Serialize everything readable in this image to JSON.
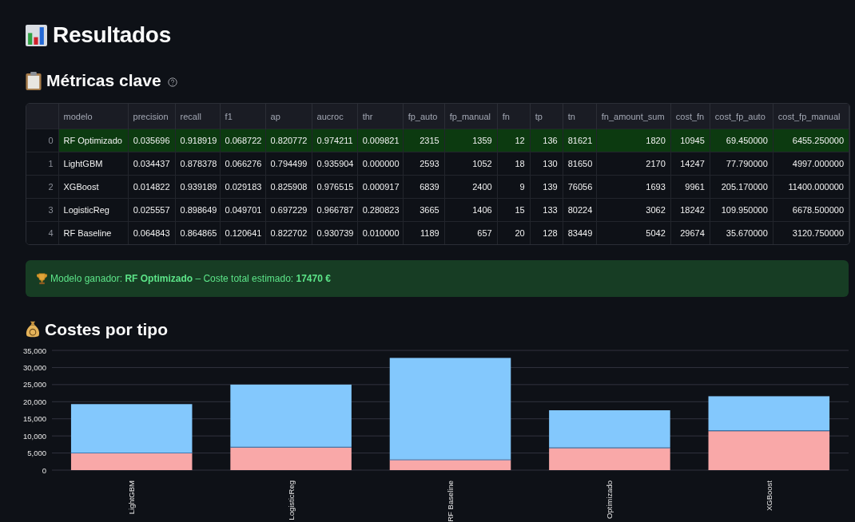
{
  "title": "Resultados",
  "metrics": {
    "heading": "Métricas clave",
    "table": {
      "columns": [
        "",
        "modelo",
        "precision",
        "recall",
        "f1",
        "ap",
        "aucroc",
        "thr",
        "fp_auto",
        "fp_manual",
        "fn",
        "tp",
        "tn",
        "fn_amount_sum",
        "cost_fn",
        "cost_fp_auto",
        "cost_fp_manual"
      ],
      "rows": [
        {
          "selected": true,
          "cells": [
            "0",
            "RF Optimizado",
            "0.035696",
            "0.918919",
            "0.068722",
            "0.820772",
            "0.974211",
            "0.009821",
            "2315",
            "1359",
            "12",
            "136",
            "81621",
            "1820",
            "10945",
            "69.450000",
            "6455.250000"
          ]
        },
        {
          "selected": false,
          "cells": [
            "1",
            "LightGBM",
            "0.034437",
            "0.878378",
            "0.066276",
            "0.794499",
            "0.935904",
            "0.000000",
            "2593",
            "1052",
            "18",
            "130",
            "81650",
            "2170",
            "14247",
            "77.790000",
            "4997.000000"
          ]
        },
        {
          "selected": false,
          "cells": [
            "2",
            "XGBoost",
            "0.014822",
            "0.939189",
            "0.029183",
            "0.825908",
            "0.976515",
            "0.000917",
            "6839",
            "2400",
            "9",
            "139",
            "76056",
            "1693",
            "9961",
            "205.170000",
            "11400.000000"
          ]
        },
        {
          "selected": false,
          "cells": [
            "3",
            "LogisticReg",
            "0.025557",
            "0.898649",
            "0.049701",
            "0.697229",
            "0.966787",
            "0.280823",
            "3665",
            "1406",
            "15",
            "133",
            "80224",
            "3062",
            "18242",
            "109.950000",
            "6678.500000"
          ]
        },
        {
          "selected": false,
          "cells": [
            "4",
            "RF Baseline",
            "0.064843",
            "0.864865",
            "0.120641",
            "0.822702",
            "0.930739",
            "0.010000",
            "1189",
            "657",
            "20",
            "128",
            "83449",
            "5042",
            "29674",
            "35.670000",
            "3120.750000"
          ]
        }
      ]
    }
  },
  "winner_message": "Modelo ganador: **RF Optimizado** – Coste total estimado: **17470 €**",
  "costs": {
    "heading": "Costes por tipo",
    "chart_data": {
      "type": "bar",
      "stacked": true,
      "grid": true,
      "categories": [
        "LightGBM",
        "LogisticReg",
        "RF Baseline",
        "Optimizado",
        "XGBoost"
      ],
      "series": [
        {
          "color": "#f9a8a8",
          "values": [
            5000,
            6700,
            3100,
            6500,
            11400
          ]
        },
        {
          "color": "#1f6fb4",
          "values": [
            100,
            100,
            0,
            100,
            200
          ]
        },
        {
          "color": "#83c8fd",
          "values": [
            14200,
            18200,
            29700,
            10900,
            10000
          ]
        }
      ],
      "ylim": [
        0,
        35000
      ],
      "yticks": [
        {
          "value": 0,
          "label": "0"
        },
        {
          "value": 5000,
          "label": "5,000"
        },
        {
          "value": 10000,
          "label": "10,000"
        },
        {
          "value": 15000,
          "label": "15,000"
        },
        {
          "value": 20000,
          "label": "20,000"
        },
        {
          "value": 25000,
          "label": "25,000"
        },
        {
          "value": 30000,
          "label": "30,000"
        },
        {
          "value": 35000,
          "label": "35,000"
        }
      ]
    }
  }
}
